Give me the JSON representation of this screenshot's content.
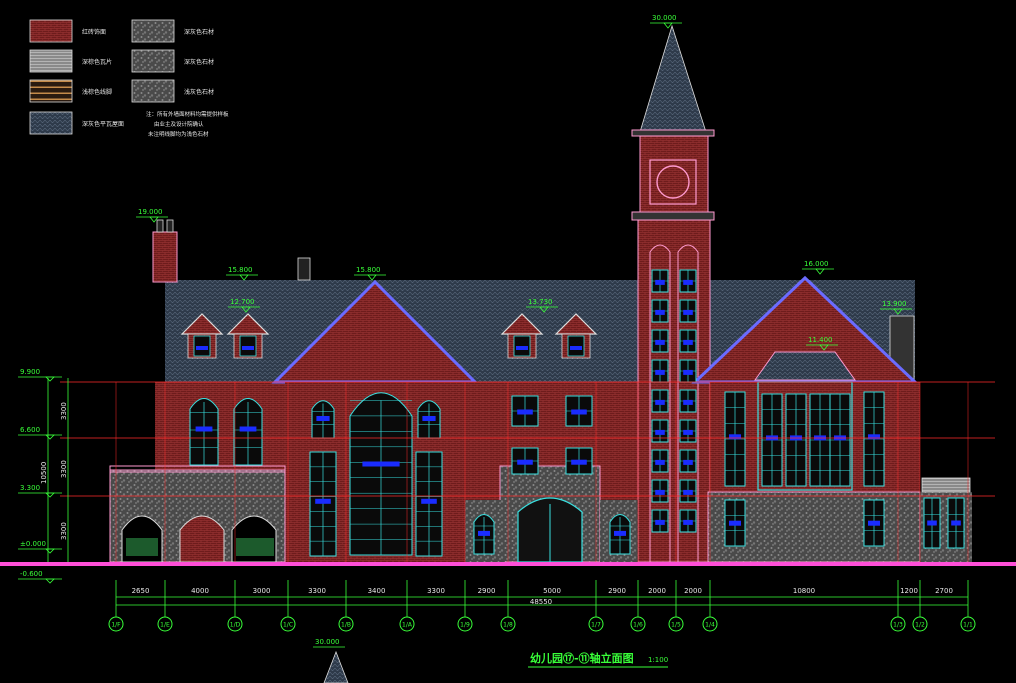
{
  "legend": [
    {
      "label": "红砖饰面",
      "swatch": "brick"
    },
    {
      "label": "深灰色石材",
      "swatch": "granite"
    },
    {
      "label": "深棕色瓦片",
      "swatch": "siding"
    },
    {
      "label": "深灰色石材",
      "swatch": "granite"
    },
    {
      "label": "浅棕色线脚",
      "swatch": "trim"
    },
    {
      "label": "浅灰色石材",
      "swatch": "granite"
    },
    {
      "label": "深灰色平瓦屋面",
      "swatch": "roof"
    }
  ],
  "notes": [
    "注：所有外墙面材料均需提供样板",
    "由业主及设计院确认",
    "未注明线脚均为浅色石材"
  ],
  "elevations_left": [
    {
      "label": "9.900"
    },
    {
      "label": "6.600"
    },
    {
      "label": "3.300"
    },
    {
      "label": "±0.000"
    },
    {
      "label": "-0.600"
    }
  ],
  "vertical_dims": [
    "3300",
    "3300",
    "3300"
  ],
  "vertical_total": "10500",
  "elevations_top": [
    {
      "label": "30.000"
    },
    {
      "label": "19.000"
    },
    {
      "label": "15.800"
    },
    {
      "label": "15.800"
    },
    {
      "label": "12.700"
    },
    {
      "label": "13.730"
    },
    {
      "label": "16.000"
    },
    {
      "label": "13.900"
    },
    {
      "label": "11.400"
    }
  ],
  "horizontal_dims": [
    "2650",
    "4000",
    "3000",
    "3300",
    "3400",
    "3300",
    "2900",
    "5000",
    "2900",
    "2000",
    "2000",
    "10800",
    "1200",
    "2700"
  ],
  "horizontal_total": "48550",
  "axis_labels": [
    "1/F",
    "1/E",
    "1/D",
    "1/C",
    "1/B",
    "1/A",
    "1/9",
    "1/8",
    "1/7",
    "1/6",
    "1/5",
    "1/4",
    "1/3",
    "1/2",
    "1/1"
  ],
  "drawing_title": "幼儿园⑰-⑪轴立面图",
  "drawing_scale": "1:100",
  "bottom_elevation": "30.000",
  "colors": {
    "background": "#000000",
    "dimension_green": "#39ff39",
    "roof_line": "#6b6bff",
    "grid_red": "#ff2a2a",
    "ground_magenta": "#ff4fd8",
    "brick": "#7a1f1f",
    "window_cyan": "#39e0e0",
    "window_glass": "#1a2cff",
    "trim_pink": "#ff9ad0"
  }
}
